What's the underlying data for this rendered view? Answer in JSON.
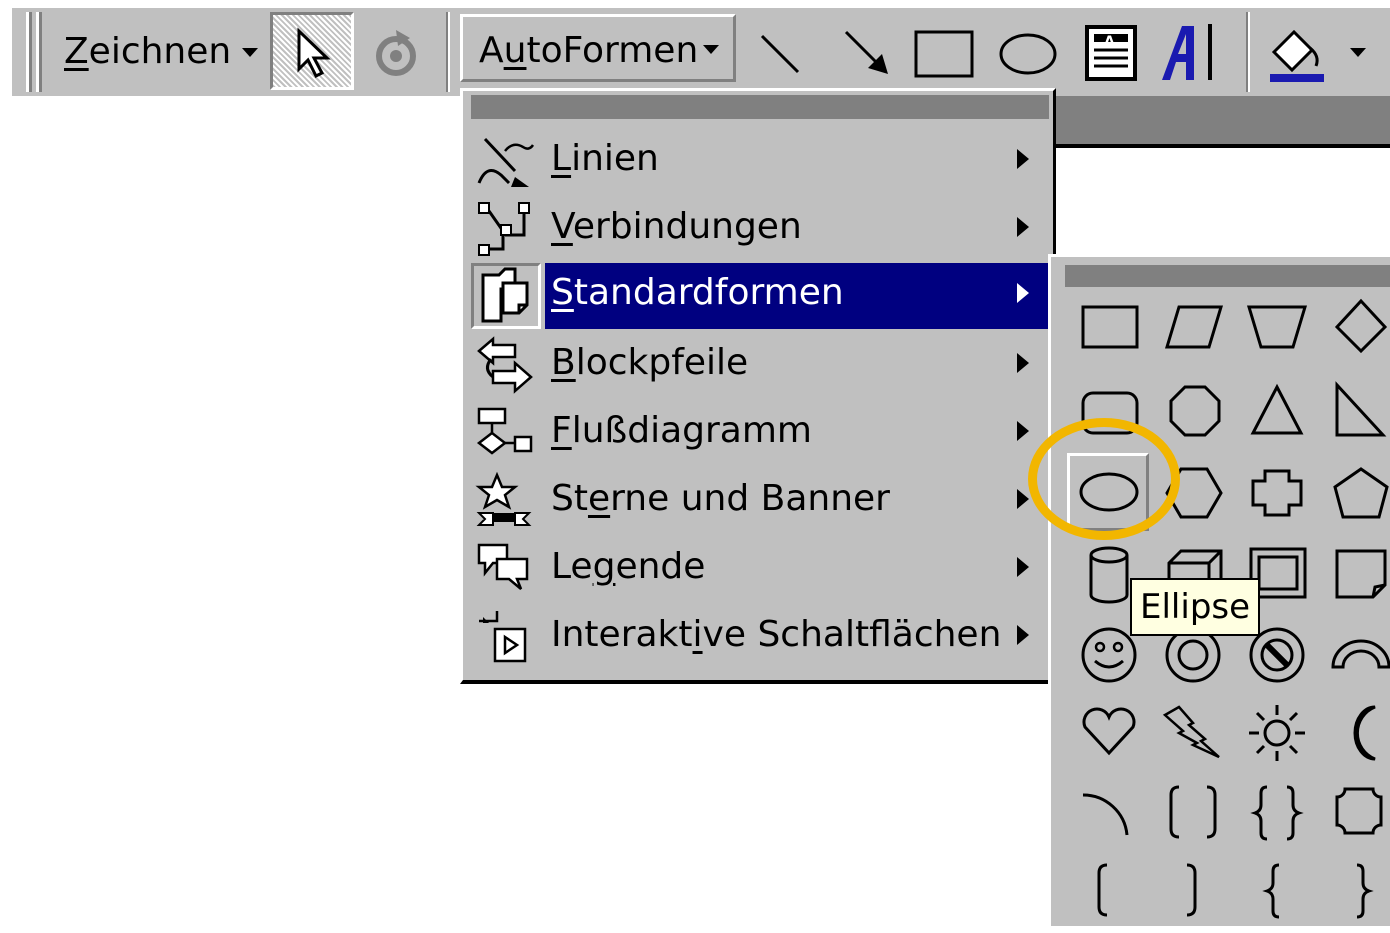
{
  "toolbar": {
    "draw_label": "Zeichnen",
    "autoshapes_label": "AutoFormen",
    "icons": [
      "select-objects-icon",
      "free-rotate-icon",
      "line-icon",
      "arrow-icon",
      "rectangle-icon",
      "oval-icon",
      "text-box-icon",
      "wordart-icon",
      "fill-color-icon"
    ]
  },
  "menu": {
    "items": [
      {
        "label": "Linien",
        "icon": "lines-icon"
      },
      {
        "label": "Verbindungen",
        "icon": "connectors-icon"
      },
      {
        "label": "Standardformen",
        "icon": "basic-shapes-icon",
        "selected": true
      },
      {
        "label": "Blockpfeile",
        "icon": "block-arrows-icon"
      },
      {
        "label": "Flußdiagramm",
        "icon": "flowchart-icon"
      },
      {
        "label": "Sterne und Banner",
        "icon": "stars-banners-icon"
      },
      {
        "label": "Legende",
        "icon": "callouts-icon"
      },
      {
        "label": "Interaktive Schaltflächen",
        "icon": "action-buttons-icon"
      }
    ]
  },
  "submenu": {
    "hovered": "oval-shape",
    "shapes": [
      "rectangle",
      "parallelogram",
      "trapezoid",
      "diamond",
      "rounded-rectangle",
      "octagon",
      "isosceles-triangle",
      "right-triangle",
      "oval",
      "hexagon",
      "cross",
      "pentagon",
      "can",
      "cube",
      "bevel",
      "folded-corner",
      "smiley-face",
      "donut",
      "no-symbol",
      "block-arc",
      "heart",
      "lightning-bolt",
      "sun",
      "moon",
      "arc",
      "double-bracket",
      "double-brace",
      "plaque",
      "left-bracket",
      "right-bracket",
      "left-brace",
      "right-brace"
    ]
  },
  "tooltip": {
    "text": "Ellipse"
  },
  "colors": {
    "face": "#c0c0c0",
    "shadow": "#808080",
    "highlight": "#ffffff",
    "selection": "#000080",
    "tooltip_bg": "#ffffe1",
    "annotation_ring": "#f2b600",
    "wordart_blue": "#1a1ab0"
  }
}
